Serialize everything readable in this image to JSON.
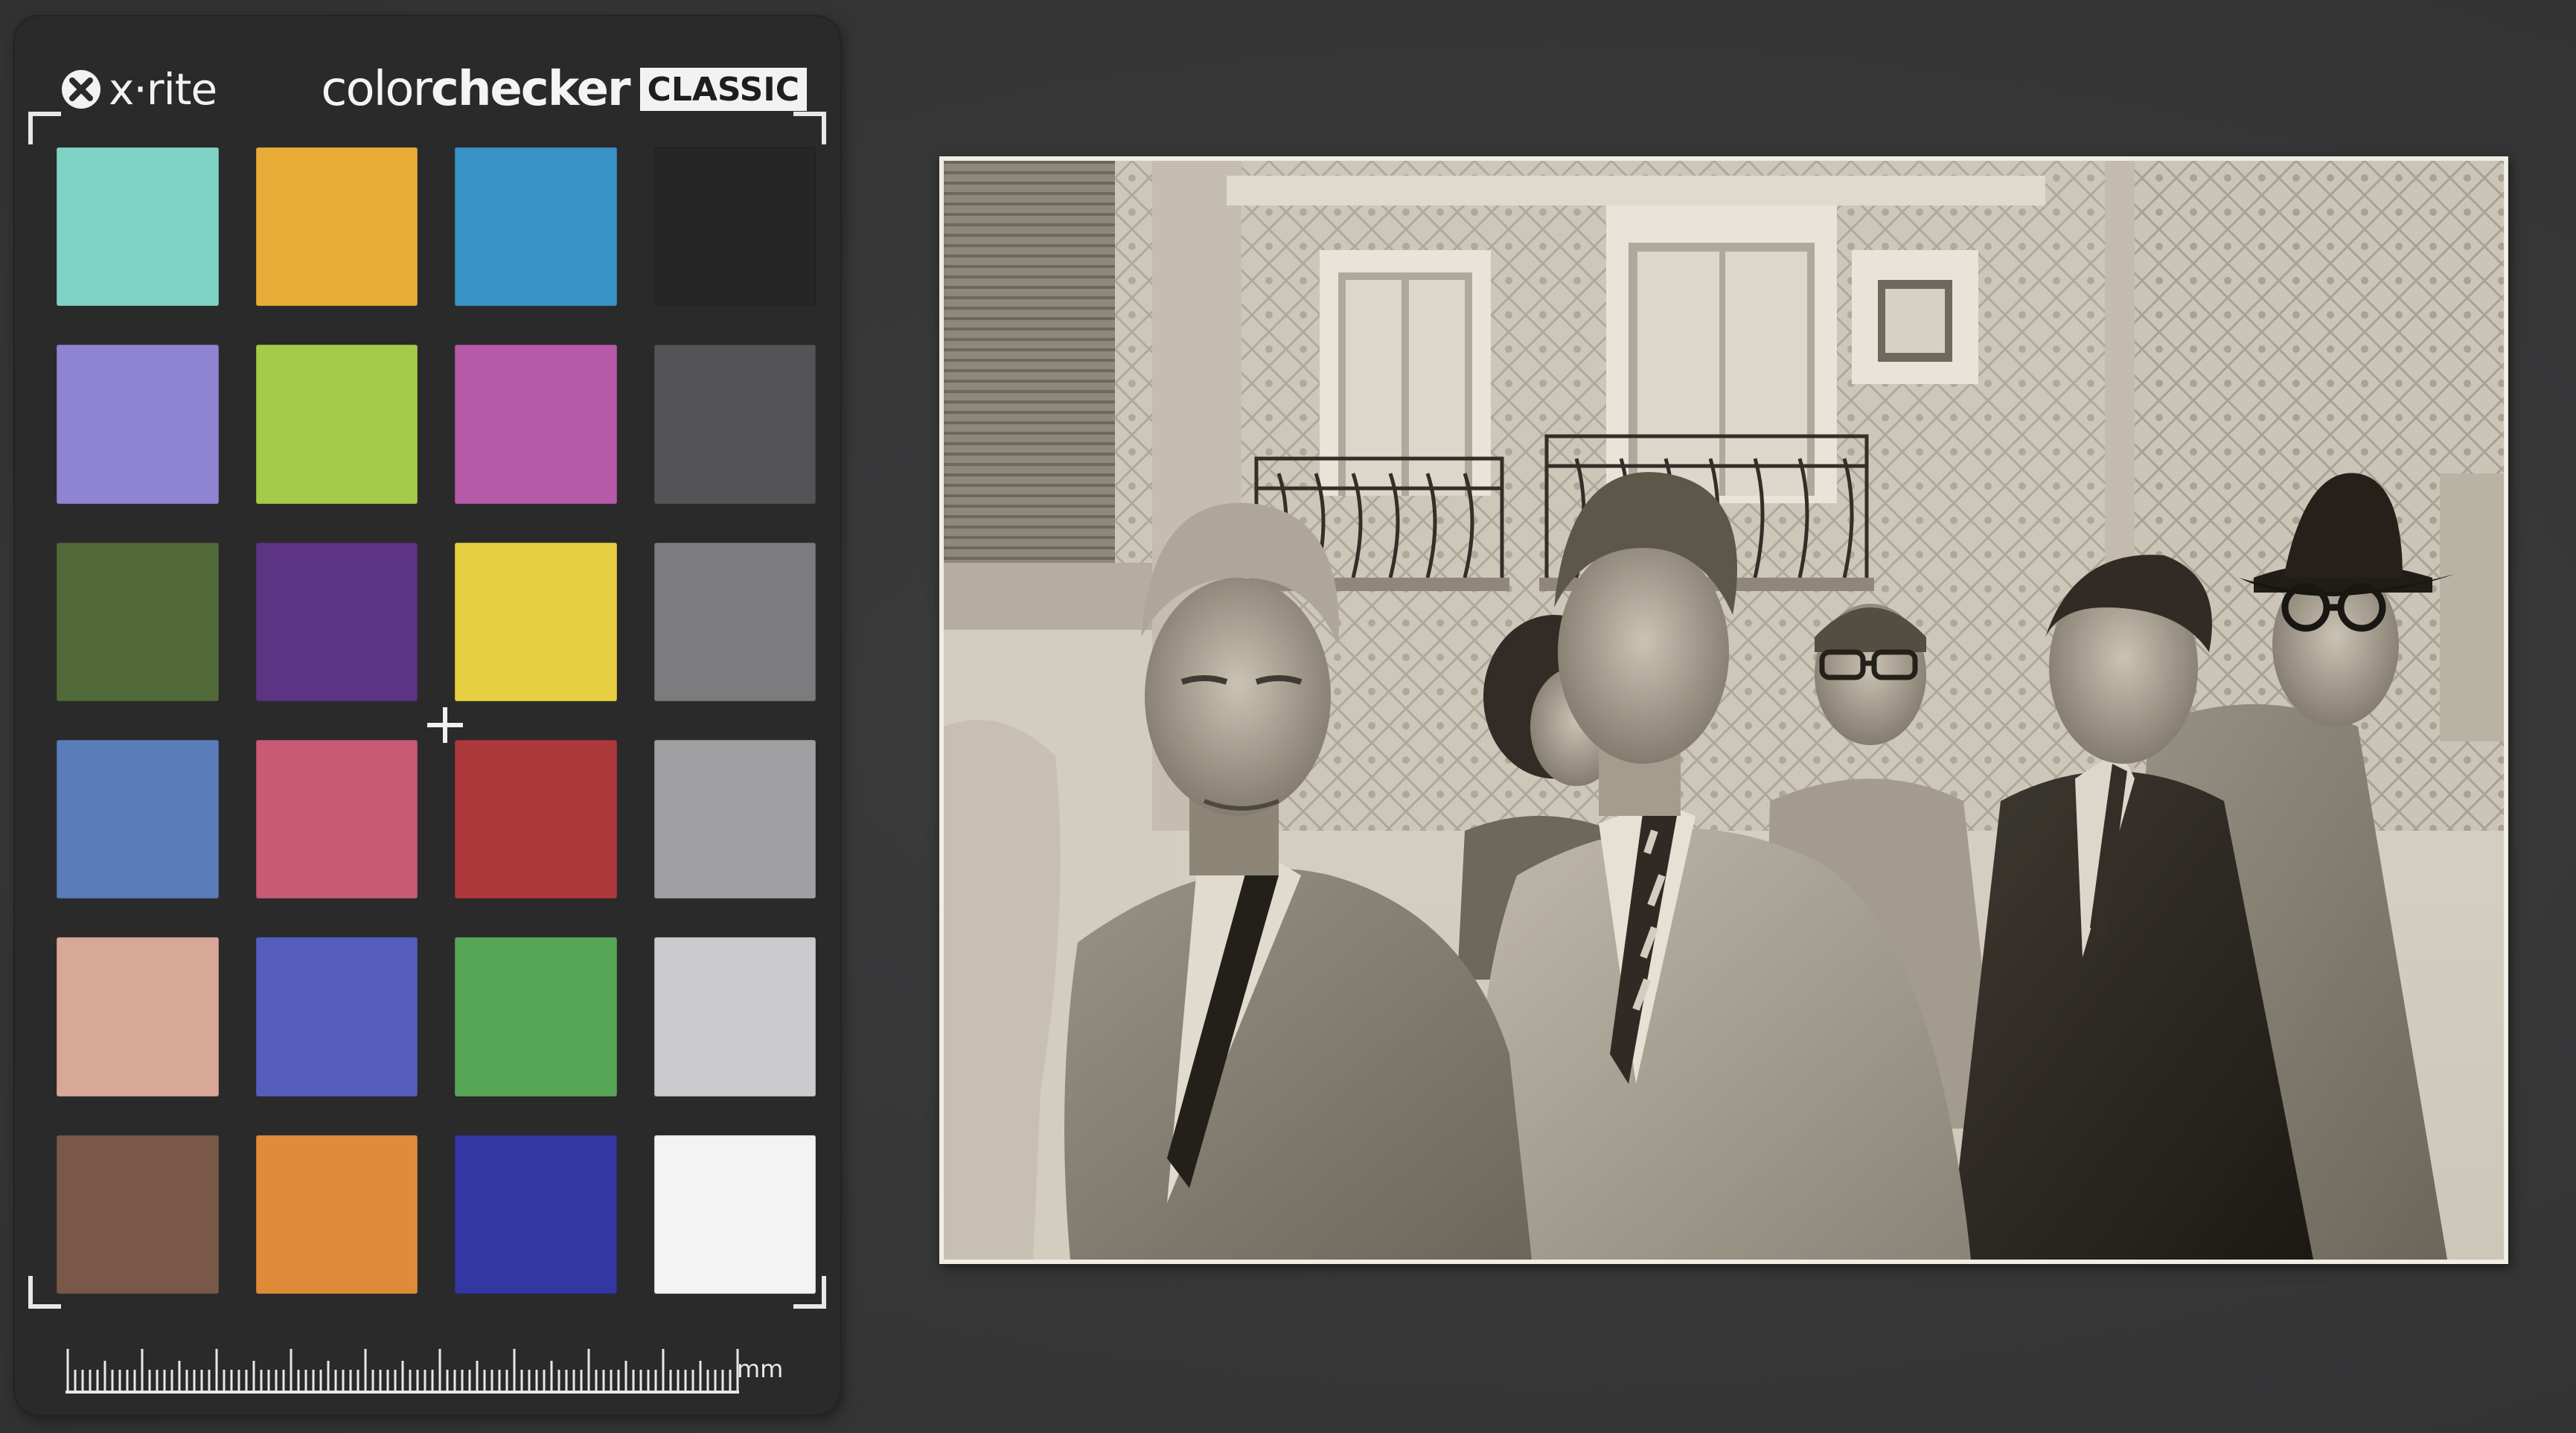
{
  "card": {
    "brand": "x·rite",
    "product_light": "color",
    "product_bold": "checker",
    "edition": "CLASSIC",
    "ruler_unit": "mm",
    "patches": [
      {
        "color": "#7fd3c4"
      },
      {
        "color": "#e9ad37"
      },
      {
        "color": "#3a93c7"
      },
      {
        "color": "#262627"
      },
      {
        "color": "#8f84d2"
      },
      {
        "color": "#a4cb4a"
      },
      {
        "color": "#b75aaa"
      },
      {
        "color": "#545456"
      },
      {
        "color": "#52693a"
      },
      {
        "color": "#5d3384"
      },
      {
        "color": "#e6d042"
      },
      {
        "color": "#7c7c7e"
      },
      {
        "color": "#5a7cb8"
      },
      {
        "color": "#c85a74"
      },
      {
        "color": "#ad393c"
      },
      {
        "color": "#a0a0a2"
      },
      {
        "color": "#d7a798"
      },
      {
        "color": "#565ebd"
      },
      {
        "color": "#57a655"
      },
      {
        "color": "#cbcbcd"
      },
      {
        "color": "#7a5848"
      },
      {
        "color": "#df8b3a"
      },
      {
        "color": "#3337a3"
      },
      {
        "color": "#f3f3f3"
      }
    ]
  },
  "photo": {
    "tone_light": "#e4dfd4",
    "tone_dark": "#1b1916",
    "tile_color": "#b7b2a7"
  }
}
